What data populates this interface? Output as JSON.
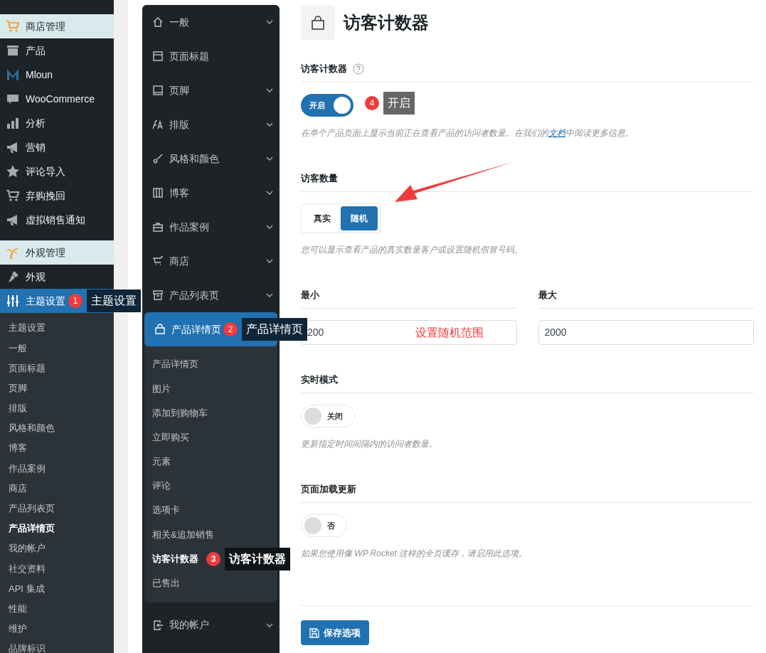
{
  "admin_menu": {
    "items": [
      {
        "label": "商店管理",
        "kind": "group",
        "selected": false
      },
      {
        "label": "产品",
        "kind": "item",
        "selected": false
      },
      {
        "label": "Mloun",
        "kind": "item",
        "selected": false
      },
      {
        "label": "WooCommerce",
        "kind": "item",
        "selected": false
      },
      {
        "label": "分析",
        "kind": "item",
        "selected": false
      },
      {
        "label": "营销",
        "kind": "item",
        "selected": false
      },
      {
        "label": "评论导入",
        "kind": "item",
        "selected": false
      },
      {
        "label": "弃购挽回",
        "kind": "item",
        "selected": false
      },
      {
        "label": "虚拟销售通知",
        "kind": "item",
        "selected": false
      },
      {
        "label": "外观管理",
        "kind": "group",
        "selected": false
      },
      {
        "label": "外观",
        "kind": "item",
        "selected": false
      },
      {
        "label": "主题设置",
        "kind": "item",
        "selected": true,
        "callout": {
          "number": "1",
          "text": "主题设置"
        }
      }
    ],
    "submenu": [
      {
        "label": "主题设置",
        "selected": false
      },
      {
        "label": "一般",
        "selected": false
      },
      {
        "label": "页面标题",
        "selected": false
      },
      {
        "label": "页脚",
        "selected": false
      },
      {
        "label": "排版",
        "selected": false
      },
      {
        "label": "风格和颜色",
        "selected": false
      },
      {
        "label": "博客",
        "selected": false
      },
      {
        "label": "作品案例",
        "selected": false
      },
      {
        "label": "商店",
        "selected": false
      },
      {
        "label": "产品列表页",
        "selected": false
      },
      {
        "label": "产品详情页",
        "selected": true
      },
      {
        "label": "我的帐户",
        "selected": false
      },
      {
        "label": "社交资料",
        "selected": false
      },
      {
        "label": "API 集成",
        "selected": false
      },
      {
        "label": "性能",
        "selected": false
      },
      {
        "label": "维护",
        "selected": false
      },
      {
        "label": "品牌标识",
        "selected": false
      }
    ]
  },
  "settings_nav": [
    {
      "label": "一般",
      "has_submenu": true,
      "selected": false
    },
    {
      "label": "页面标题",
      "has_submenu": false,
      "selected": false
    },
    {
      "label": "页脚",
      "has_submenu": true,
      "selected": false
    },
    {
      "label": "排版",
      "has_submenu": true,
      "selected": false
    },
    {
      "label": "风格和颜色",
      "has_submenu": true,
      "selected": false
    },
    {
      "label": "博客",
      "has_submenu": true,
      "selected": false
    },
    {
      "label": "作品案例",
      "has_submenu": true,
      "selected": false
    },
    {
      "label": "商店",
      "has_submenu": true,
      "selected": false
    },
    {
      "label": "产品列表页",
      "has_submenu": true,
      "selected": false
    },
    {
      "label": "产品详情页",
      "has_submenu": false,
      "selected": true,
      "expanded": true,
      "callout": {
        "number": "2",
        "text": "产品详情页"
      },
      "children": [
        {
          "label": "产品详情页",
          "selected": false
        },
        {
          "label": "图片",
          "selected": false
        },
        {
          "label": "添加到购物车",
          "selected": false
        },
        {
          "label": "立即购买",
          "selected": false
        },
        {
          "label": "元素",
          "selected": false
        },
        {
          "label": "评论",
          "selected": false
        },
        {
          "label": "选项卡",
          "selected": false
        },
        {
          "label": "相关&追加销售",
          "selected": false
        },
        {
          "label": "访客计数器",
          "selected": true,
          "callout": {
            "number": "3",
            "text": "访客计数器"
          }
        },
        {
          "label": "已售出",
          "selected": false
        }
      ]
    },
    {
      "label": "我的帐户",
      "has_submenu": true,
      "selected": false
    }
  ],
  "page": {
    "title": "访客计数器",
    "sections": [
      {
        "kind": "toggle",
        "label": "访客计数器",
        "help": true,
        "on": true,
        "toggle_text": "开启",
        "callout": {
          "number": "4",
          "text": "开启"
        },
        "description": "在单个产品页面上显示当前正在查看产品的访问者数量。在我们的",
        "link": "文档",
        "description_after": "中阅读更多信息。"
      },
      {
        "kind": "segmented",
        "label": "访客数量",
        "options": [
          {
            "label": "真实",
            "selected": false
          },
          {
            "label": "随机",
            "selected": true
          }
        ],
        "description": "您可以显示查看产品的真实数量客户或设置随机假冒号码。"
      },
      {
        "kind": "range",
        "fields": [
          {
            "label": "最小",
            "value": "200",
            "note": "设置随机范围"
          },
          {
            "label": "最大",
            "value": "2000"
          }
        ]
      },
      {
        "kind": "toggle",
        "label": "实时模式",
        "help": false,
        "on": false,
        "toggle_text": "关闭",
        "description": "更新指定时间间隔内的访问者数量。"
      },
      {
        "kind": "toggle",
        "label": "页面加载更新",
        "help": false,
        "on": false,
        "toggle_text": "否",
        "description": "如果您使用像 WP Rocket 这样的全页缓存，请启用此选项。"
      }
    ],
    "save_button": "保存选项"
  }
}
